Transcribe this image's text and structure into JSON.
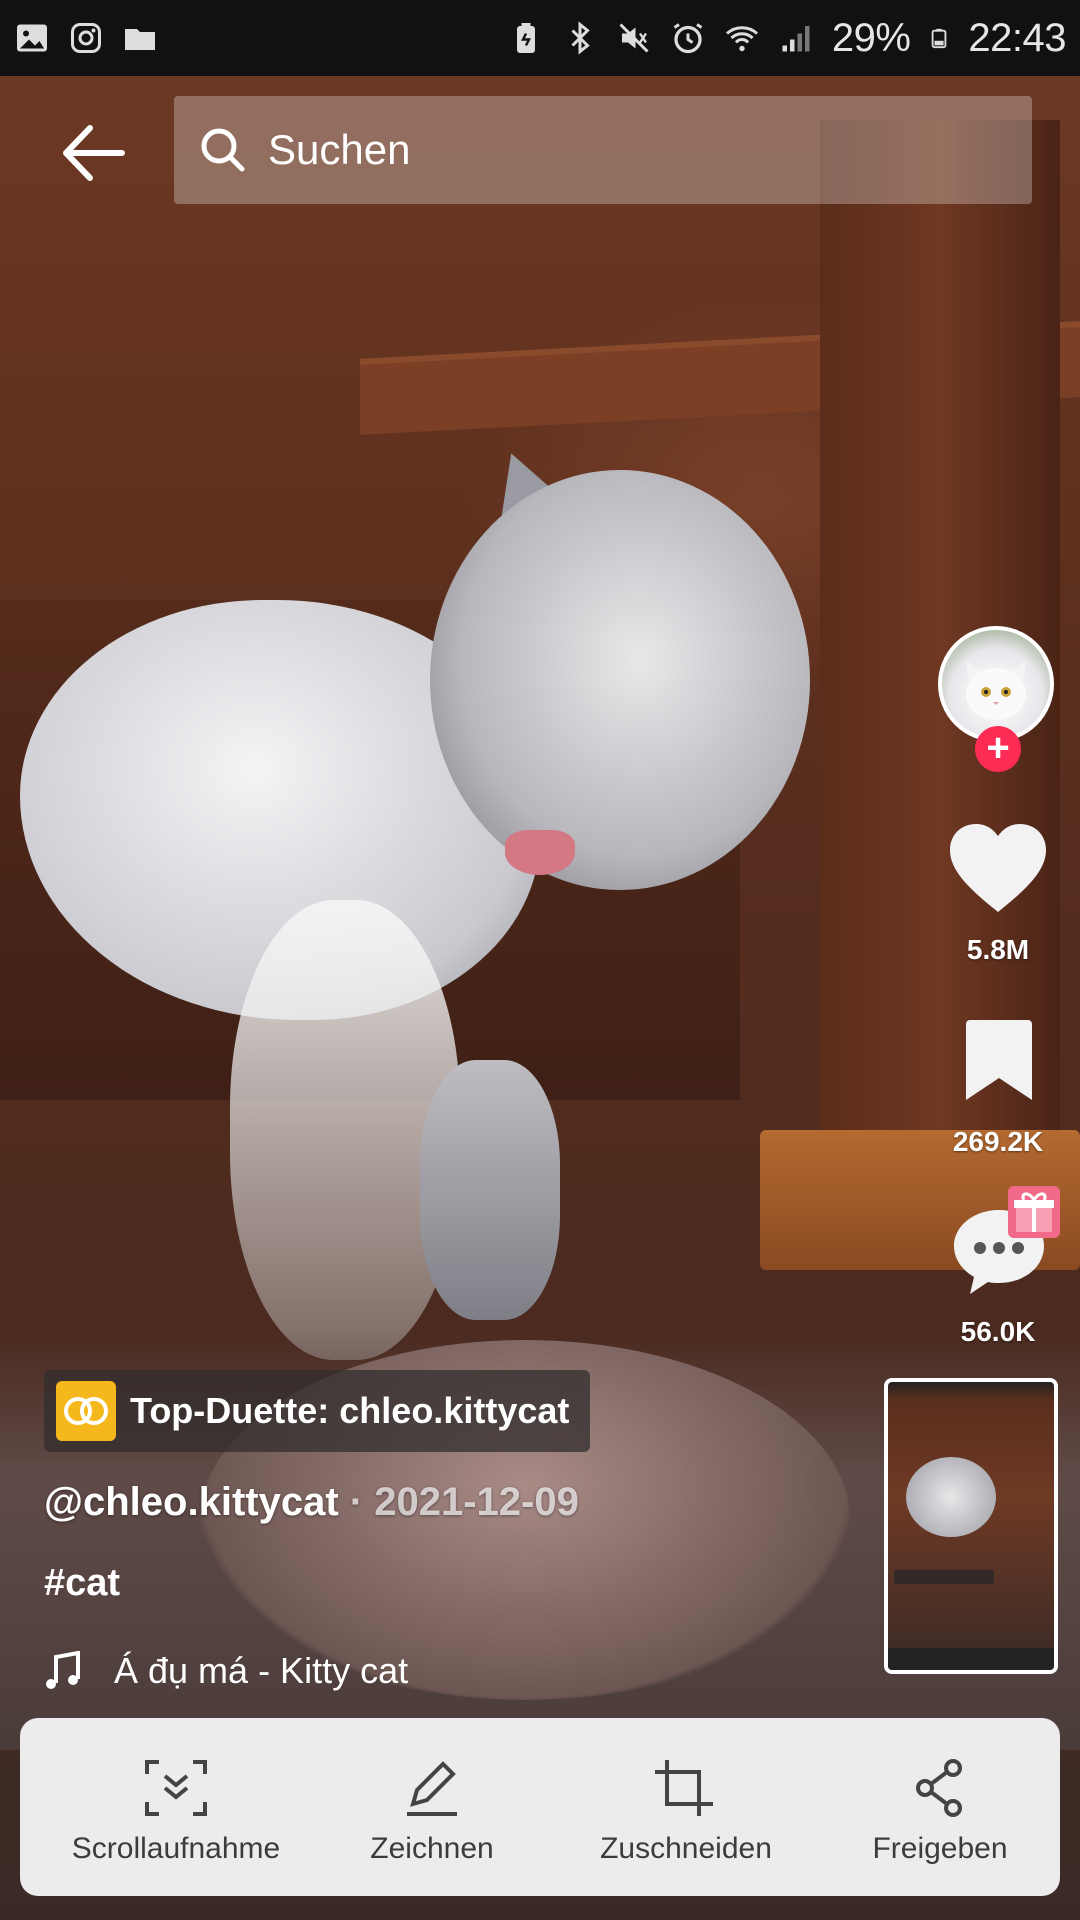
{
  "status_bar": {
    "icons_left": [
      "gallery-icon",
      "instagram-icon",
      "folder-icon"
    ],
    "icons_right": [
      "battery-saver-icon",
      "bluetooth-icon",
      "mute-icon",
      "alarm-icon",
      "wifi-icon",
      "signal-icon"
    ],
    "battery_percent": "29%",
    "time": "22:43"
  },
  "top_bar": {
    "back_icon": "arrow-left-icon",
    "search_icon": "search-icon",
    "search_placeholder": "Suchen"
  },
  "actions": {
    "likes": "5.8M",
    "saves": "269.2K",
    "comments": "56.0K"
  },
  "video_info": {
    "duet_label": "Top-Duette: chleo.kittycat",
    "username": "@chleo.kittycat",
    "separator": " · ",
    "date": "2021-12-09",
    "hashtag": "#cat",
    "sound": "Á đụ má - Kitty cat"
  },
  "capture_toolbar": {
    "items": [
      {
        "label": "Scrollaufnahme",
        "icon": "scroll-capture-icon"
      },
      {
        "label": "Zeichnen",
        "icon": "pen-icon"
      },
      {
        "label": "Zuschneiden",
        "icon": "crop-icon"
      },
      {
        "label": "Freigeben",
        "icon": "share-icon"
      }
    ]
  },
  "colors": {
    "follow_plus": "#fe2c55",
    "duet_badge": "#f5b81c",
    "panel_bg": "#ececec"
  }
}
